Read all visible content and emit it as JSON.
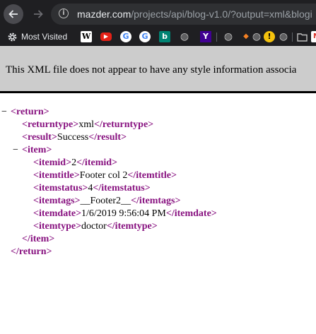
{
  "browser": {
    "address_host": "mazder.com",
    "address_path": "/projects/api/blog-v1.0/?output=xml&blogi",
    "info_glyph": "i",
    "back_icon": "arrow-left-icon",
    "forward_icon": "arrow-right-icon"
  },
  "bookmarks": {
    "most_visited_label": "Most Visited",
    "items": [
      {
        "icon": "wikipedia-icon",
        "glyph": "W"
      },
      {
        "icon": "youtube-icon",
        "glyph": "▶"
      },
      {
        "icon": "google-icon",
        "glyph": "G"
      },
      {
        "icon": "google-icon",
        "glyph": "G"
      },
      {
        "icon": "bing-icon",
        "glyph": "b"
      },
      {
        "icon": "globe-icon",
        "glyph": "◍"
      },
      {
        "icon": "yahoo-icon",
        "glyph": "Y"
      },
      {
        "icon": "globe-icon",
        "glyph": "◍"
      },
      {
        "icon": "arrow-icon",
        "glyph": "◆"
      },
      {
        "icon": "globe-icon",
        "glyph": "◍"
      },
      {
        "icon": "warning-icon",
        "glyph": "!"
      },
      {
        "icon": "globe-icon",
        "glyph": "◍"
      },
      {
        "icon": "folder-icon",
        "glyph": ""
      },
      {
        "icon": "gmail-icon",
        "glyph": "M"
      }
    ]
  },
  "banner": {
    "message": "This XML file does not appear to have any style information associa"
  },
  "xml": {
    "fold_glyph": "−",
    "return_open": "<return>",
    "return_close": "</return>",
    "returntype_open": "<returntype>",
    "returntype_value": "xml",
    "returntype_close": "</returntype>",
    "result_open": "<result>",
    "result_value": "Success",
    "result_close": "</result>",
    "item_open": "<item>",
    "item_close": "</item>",
    "itemid_open": "<itemid>",
    "itemid_value": "2",
    "itemid_close": "</itemid>",
    "itemtitle_open": "<itemtitle>",
    "itemtitle_value": "Footer col 2",
    "itemtitle_close": "</itemtitle>",
    "itemstatus_open": "<itemstatus>",
    "itemstatus_value": "4",
    "itemstatus_close": "</itemstatus>",
    "itemtags_open": "<itemtags>",
    "itemtags_value": "__Footer2__",
    "itemtags_close": "</itemtags>",
    "itemdate_open": "<itemdate>",
    "itemdate_value": "1/6/2019 9:56:04 PM",
    "itemdate_close": "</itemdate>",
    "itemtype_open": "<itemtype>",
    "itemtype_value": "doctor",
    "itemtype_close": "</itemtype>"
  },
  "colors": {
    "chrome_bg": "#1f1f22",
    "urlbar_bg": "#2f3033",
    "banner_bg": "#cccccc",
    "tag": "#881280"
  }
}
